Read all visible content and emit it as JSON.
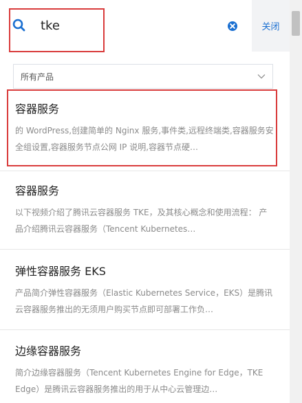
{
  "search": {
    "query": "tke",
    "close_label": "关闭"
  },
  "filter": {
    "selected": "所有产品"
  },
  "results": [
    {
      "title": "容器服务",
      "desc": "的 WordPress,创建简单的 Nginx 服务,事件类,远程终端类,容器服务安全组设置,容器服务节点公网 IP 说明,容器节点硬…"
    },
    {
      "title": "容器服务",
      "desc": "以下视频介绍了腾讯云容器服务 TKE，及其核心概念和使用流程： 产品介绍腾讯云容器服务（Tencent Kubernetes…"
    },
    {
      "title": "弹性容器服务 EKS",
      "desc": "产品简介弹性容器服务（Elastic Kubernetes Service，EKS）是腾讯云容器服务推出的无须用户购买节点即可部署工作负…"
    },
    {
      "title": "边缘容器服务",
      "desc": "简介边缘容器服务（Tencent Kubernetes Engine for Edge，TKE Edge）是腾讯云容器服务推出的用于从中心云管理边…"
    }
  ],
  "colors": {
    "accent": "#1a6fd1",
    "highlight": "#d93a3a"
  }
}
